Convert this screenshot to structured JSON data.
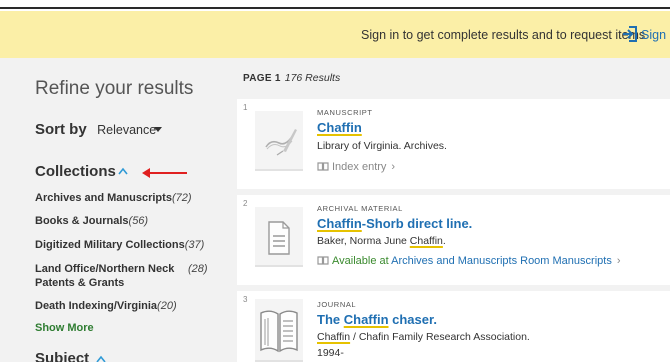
{
  "signin": {
    "message": "Sign in to get complete results and to request items",
    "link": "Sign i"
  },
  "sidebar": {
    "title": "Refine your results",
    "sort_label": "Sort by",
    "sort_value": "Relevance",
    "collections_label": "Collections",
    "facets": [
      {
        "label": "Archives and Manuscripts",
        "count": "(72)"
      },
      {
        "label": "Books & Journals",
        "count": "(56)"
      },
      {
        "label": "Digitized Military Collections",
        "count": "(37)"
      },
      {
        "label": "Land Office/Northern Neck",
        "label2": "Patents & Grants",
        "count": "(28)"
      },
      {
        "label": "Death Indexing/Virginia",
        "count": "(20)"
      }
    ],
    "show_more": "Show More",
    "subject_label": "Subject"
  },
  "results": {
    "page_label": "PAGE 1",
    "count_label": "176 Results",
    "items": [
      {
        "num": "1",
        "type": "MANUSCRIPT",
        "title_hl": "Chaffin",
        "title_rest": "",
        "sub": "Library of Virginia. Archives.",
        "avail": "Index entry",
        "thumb_icon": "manuscript-icon"
      },
      {
        "num": "2",
        "type": "ARCHIVAL MATERIAL",
        "title_hl": "Chaffin",
        "title_rest": "-Shorb direct line.",
        "sub_pre": "Baker, Norma June ",
        "sub_hl": "Chaffin",
        "sub_post": ".",
        "avail_pre": "Available at ",
        "avail_loc": "Archives and Manuscripts Room  Manuscripts",
        "thumb_icon": "document-icon"
      },
      {
        "num": "3",
        "type": "JOURNAL",
        "title_pre": "The ",
        "title_hl": "Chaffin",
        "title_rest": " chaser.",
        "sub_hl": "Chaffin",
        "sub_post": " / Chafin Family Research Association.",
        "sub2": "1994-",
        "thumb_icon": "open-book-icon"
      }
    ]
  },
  "colors": {
    "signin_bg": "#fbefa7",
    "link_blue": "#1f6fb2",
    "highlight_yellow": "#e6c200",
    "available_green": "#3a8a2e",
    "annotation_red": "#e02020"
  }
}
